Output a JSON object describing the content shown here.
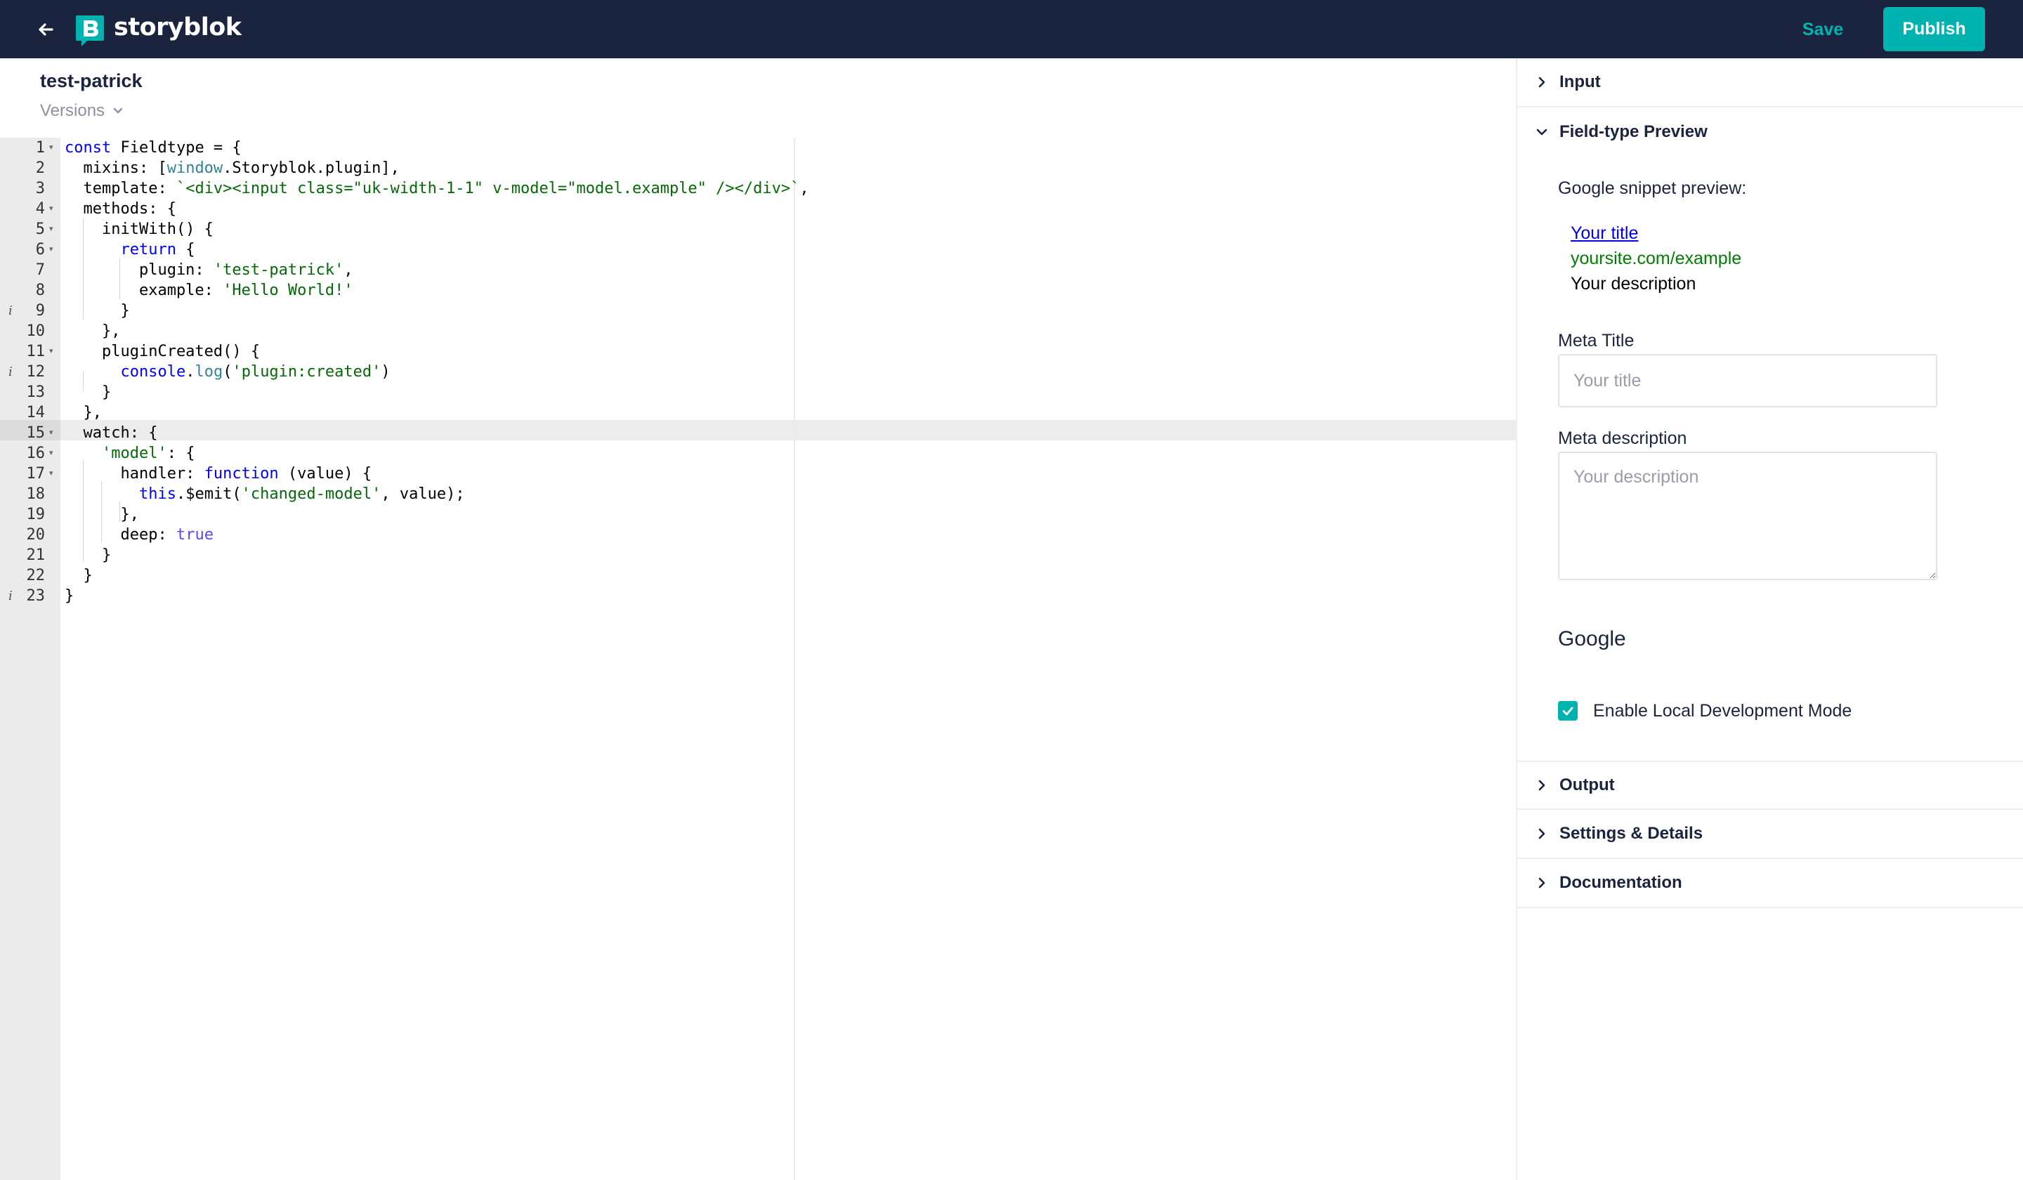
{
  "topbar": {
    "logo_text": "storyblok",
    "save_label": "Save",
    "publish_label": "Publish",
    "background": "#1b243f",
    "accent": "#00b3b0"
  },
  "header": {
    "title": "test-patrick",
    "versions_label": "Versions"
  },
  "editor": {
    "line_numbers": [
      "1",
      "2",
      "3",
      "4",
      "5",
      "6",
      "7",
      "8",
      "9",
      "10",
      "11",
      "12",
      "13",
      "14",
      "15",
      "16",
      "17",
      "18",
      "19",
      "20",
      "21",
      "22",
      "23"
    ],
    "active_line": "15",
    "lines": [
      "const Fieldtype = {",
      "  mixins: [window.Storyblok.plugin],",
      "  template: `<div><input class=\"uk-width-1-1\" v-model=\"model.example\" /></div>`,",
      "  methods: {",
      "    initWith() {",
      "      return {",
      "        plugin: 'test-patrick',",
      "        example: 'Hello World!'",
      "      }",
      "    },",
      "    pluginCreated() {",
      "      console.log('plugin:created')",
      "    }",
      "  },",
      "  watch: {",
      "    'model': {",
      "      handler: function (value) {",
      "        this.$emit('changed-model', value);",
      "      },",
      "      deep: true",
      "    }",
      "  }",
      "}"
    ]
  },
  "panel": {
    "sections": {
      "input": "Input",
      "preview": "Field-type Preview",
      "output": "Output",
      "settings": "Settings & Details",
      "documentation": "Documentation"
    },
    "snippet": {
      "label": "Google snippet preview:",
      "title": "Your title",
      "url": "yoursite.com/example",
      "description": "Your description"
    },
    "meta_title": {
      "label": "Meta Title",
      "placeholder": "Your title"
    },
    "meta_description": {
      "label": "Meta description",
      "placeholder": "Your description"
    },
    "google_heading": "Google",
    "local_dev_mode": {
      "label": "Enable Local Development Mode",
      "checked": true
    }
  }
}
